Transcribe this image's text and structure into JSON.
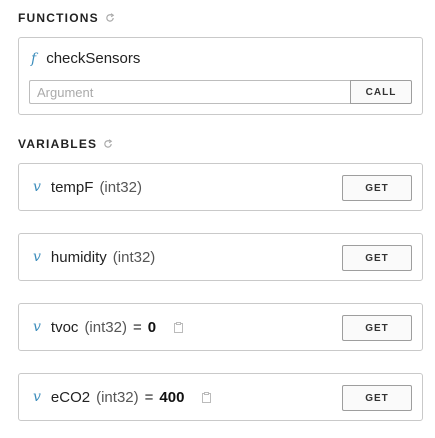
{
  "functions": {
    "title": "FUNCTIONS",
    "items": [
      {
        "badge": "f",
        "name": "checkSensors",
        "arg_placeholder": "Argument",
        "arg_value": "",
        "button_label": "CALL"
      }
    ]
  },
  "variables": {
    "title": "VARIABLES",
    "items": [
      {
        "badge": "v",
        "name": "tempF",
        "type": "(int32)",
        "equals": "",
        "value": "",
        "button_label": "GET"
      },
      {
        "badge": "v",
        "name": "humidity",
        "type": "(int32)",
        "equals": "",
        "value": "",
        "button_label": "GET"
      },
      {
        "badge": "v",
        "name": "tvoc",
        "type": "(int32)",
        "equals": "=",
        "value": "0",
        "button_label": "GET"
      },
      {
        "badge": "v",
        "name": "eCO2",
        "type": "(int32)",
        "equals": "=",
        "value": "400",
        "button_label": "GET"
      }
    ]
  },
  "icons": {
    "refresh": "refresh-icon",
    "copy": "copy-icon"
  },
  "colors": {
    "accent": "#3c8dbc",
    "border": "#c9c9c9"
  }
}
